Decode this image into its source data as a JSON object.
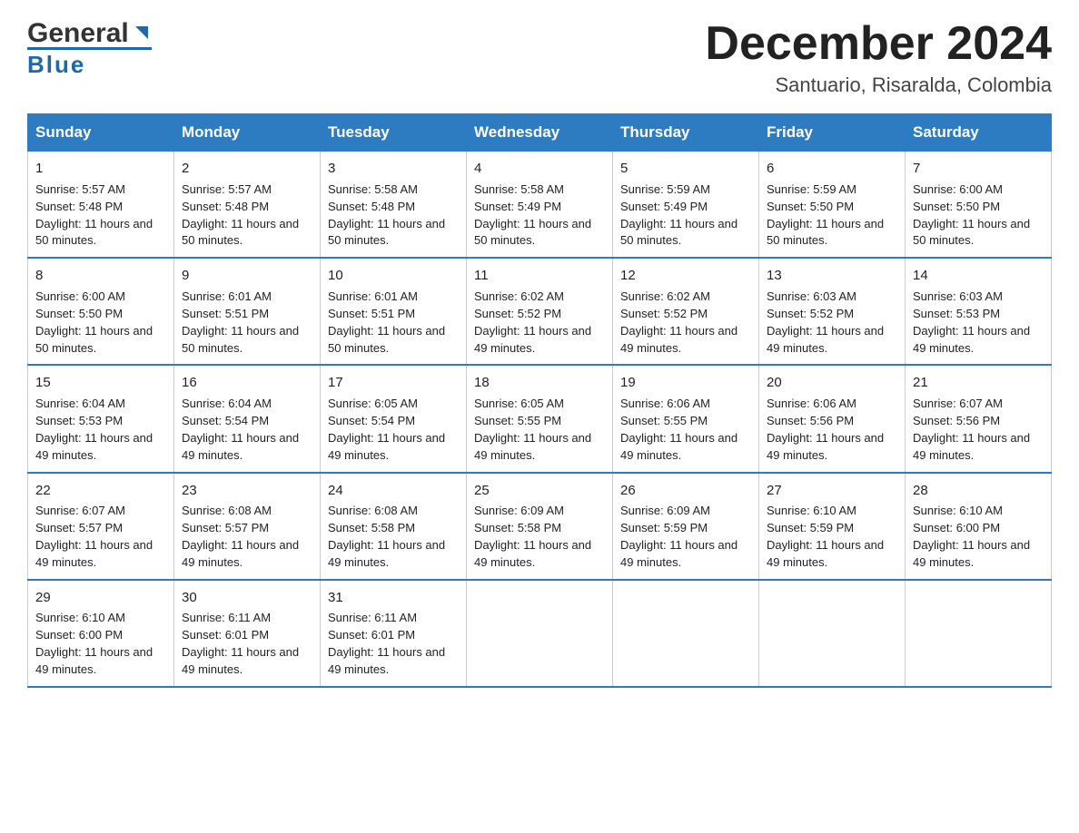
{
  "header": {
    "logo": {
      "general": "General",
      "blue": "Blue"
    },
    "title": "December 2024",
    "subtitle": "Santuario, Risaralda, Colombia"
  },
  "days_header": [
    "Sunday",
    "Monday",
    "Tuesday",
    "Wednesday",
    "Thursday",
    "Friday",
    "Saturday"
  ],
  "weeks": [
    [
      {
        "day": "1",
        "sunrise": "5:57 AM",
        "sunset": "5:48 PM",
        "daylight": "11 hours and 50 minutes."
      },
      {
        "day": "2",
        "sunrise": "5:57 AM",
        "sunset": "5:48 PM",
        "daylight": "11 hours and 50 minutes."
      },
      {
        "day": "3",
        "sunrise": "5:58 AM",
        "sunset": "5:48 PM",
        "daylight": "11 hours and 50 minutes."
      },
      {
        "day": "4",
        "sunrise": "5:58 AM",
        "sunset": "5:49 PM",
        "daylight": "11 hours and 50 minutes."
      },
      {
        "day": "5",
        "sunrise": "5:59 AM",
        "sunset": "5:49 PM",
        "daylight": "11 hours and 50 minutes."
      },
      {
        "day": "6",
        "sunrise": "5:59 AM",
        "sunset": "5:50 PM",
        "daylight": "11 hours and 50 minutes."
      },
      {
        "day": "7",
        "sunrise": "6:00 AM",
        "sunset": "5:50 PM",
        "daylight": "11 hours and 50 minutes."
      }
    ],
    [
      {
        "day": "8",
        "sunrise": "6:00 AM",
        "sunset": "5:50 PM",
        "daylight": "11 hours and 50 minutes."
      },
      {
        "day": "9",
        "sunrise": "6:01 AM",
        "sunset": "5:51 PM",
        "daylight": "11 hours and 50 minutes."
      },
      {
        "day": "10",
        "sunrise": "6:01 AM",
        "sunset": "5:51 PM",
        "daylight": "11 hours and 50 minutes."
      },
      {
        "day": "11",
        "sunrise": "6:02 AM",
        "sunset": "5:52 PM",
        "daylight": "11 hours and 49 minutes."
      },
      {
        "day": "12",
        "sunrise": "6:02 AM",
        "sunset": "5:52 PM",
        "daylight": "11 hours and 49 minutes."
      },
      {
        "day": "13",
        "sunrise": "6:03 AM",
        "sunset": "5:52 PM",
        "daylight": "11 hours and 49 minutes."
      },
      {
        "day": "14",
        "sunrise": "6:03 AM",
        "sunset": "5:53 PM",
        "daylight": "11 hours and 49 minutes."
      }
    ],
    [
      {
        "day": "15",
        "sunrise": "6:04 AM",
        "sunset": "5:53 PM",
        "daylight": "11 hours and 49 minutes."
      },
      {
        "day": "16",
        "sunrise": "6:04 AM",
        "sunset": "5:54 PM",
        "daylight": "11 hours and 49 minutes."
      },
      {
        "day": "17",
        "sunrise": "6:05 AM",
        "sunset": "5:54 PM",
        "daylight": "11 hours and 49 minutes."
      },
      {
        "day": "18",
        "sunrise": "6:05 AM",
        "sunset": "5:55 PM",
        "daylight": "11 hours and 49 minutes."
      },
      {
        "day": "19",
        "sunrise": "6:06 AM",
        "sunset": "5:55 PM",
        "daylight": "11 hours and 49 minutes."
      },
      {
        "day": "20",
        "sunrise": "6:06 AM",
        "sunset": "5:56 PM",
        "daylight": "11 hours and 49 minutes."
      },
      {
        "day": "21",
        "sunrise": "6:07 AM",
        "sunset": "5:56 PM",
        "daylight": "11 hours and 49 minutes."
      }
    ],
    [
      {
        "day": "22",
        "sunrise": "6:07 AM",
        "sunset": "5:57 PM",
        "daylight": "11 hours and 49 minutes."
      },
      {
        "day": "23",
        "sunrise": "6:08 AM",
        "sunset": "5:57 PM",
        "daylight": "11 hours and 49 minutes."
      },
      {
        "day": "24",
        "sunrise": "6:08 AM",
        "sunset": "5:58 PM",
        "daylight": "11 hours and 49 minutes."
      },
      {
        "day": "25",
        "sunrise": "6:09 AM",
        "sunset": "5:58 PM",
        "daylight": "11 hours and 49 minutes."
      },
      {
        "day": "26",
        "sunrise": "6:09 AM",
        "sunset": "5:59 PM",
        "daylight": "11 hours and 49 minutes."
      },
      {
        "day": "27",
        "sunrise": "6:10 AM",
        "sunset": "5:59 PM",
        "daylight": "11 hours and 49 minutes."
      },
      {
        "day": "28",
        "sunrise": "6:10 AM",
        "sunset": "6:00 PM",
        "daylight": "11 hours and 49 minutes."
      }
    ],
    [
      {
        "day": "29",
        "sunrise": "6:10 AM",
        "sunset": "6:00 PM",
        "daylight": "11 hours and 49 minutes."
      },
      {
        "day": "30",
        "sunrise": "6:11 AM",
        "sunset": "6:01 PM",
        "daylight": "11 hours and 49 minutes."
      },
      {
        "day": "31",
        "sunrise": "6:11 AM",
        "sunset": "6:01 PM",
        "daylight": "11 hours and 49 minutes."
      },
      null,
      null,
      null,
      null
    ]
  ]
}
